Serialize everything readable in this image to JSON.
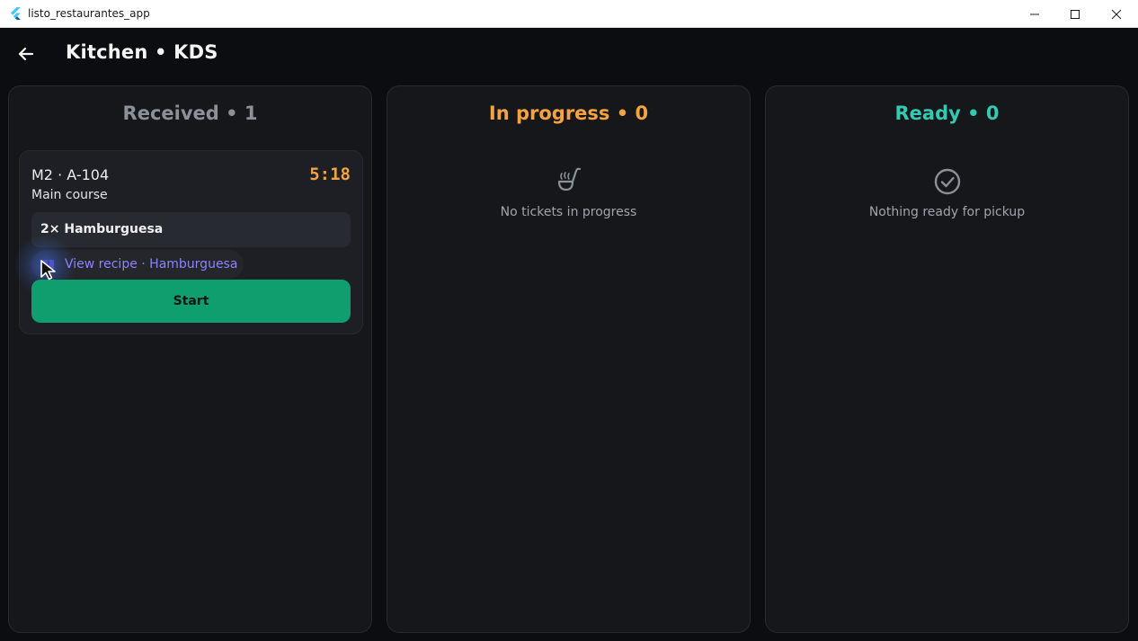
{
  "window": {
    "title": "listo_restaurantes_app",
    "icon": "flutter-logo-icon"
  },
  "header": {
    "title": "Kitchen • KDS",
    "back_icon": "arrow-left-icon"
  },
  "columns": [
    {
      "title": "Received • 1",
      "color": "#8b9099",
      "tickets": [
        {
          "id": "M2 · A-104",
          "course": "Main course",
          "timer": "5:18",
          "items": [
            "2× Hamburguesa"
          ],
          "recipe_link": "View recipe · Hamburguesa",
          "action_label": "Start"
        }
      ]
    },
    {
      "title": "In progress • 0",
      "color": "#f5a340",
      "empty_icon": "soup-ladle-icon",
      "empty_text": "No tickets in progress"
    },
    {
      "title": "Ready • 0",
      "color": "#34c9b1",
      "empty_icon": "check-circle-icon",
      "empty_text": "Nothing ready for pickup"
    }
  ],
  "colors": {
    "background": "#0c0d10",
    "panel": "#15171b",
    "card": "#1d1f24",
    "accent_orange": "#f5a340",
    "accent_teal": "#34c9b1",
    "action_green": "#0f9e6e",
    "link_purple": "#8a84ff"
  }
}
